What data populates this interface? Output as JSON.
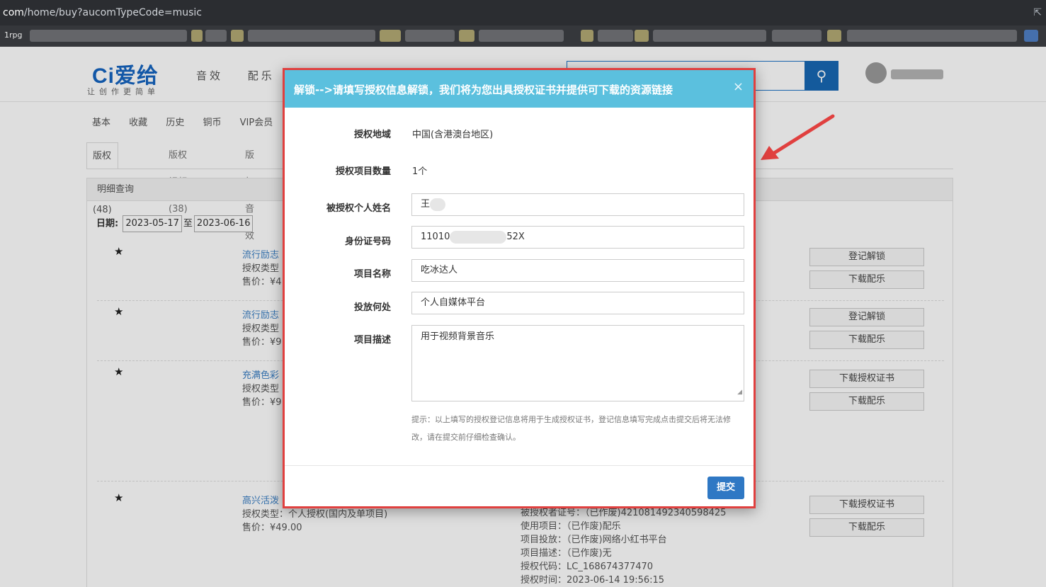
{
  "browser": {
    "url_host": "com",
    "url_path": "/home/buy?aucomTypeCode=music",
    "bookmark_label": "1rpg"
  },
  "site": {
    "logo": "Ci爱给",
    "slogan": "让创作更简单",
    "top_nav": [
      "音效",
      "配乐"
    ],
    "sub_nav": [
      "基本",
      "收藏",
      "历史",
      "铜币",
      "VIP会员"
    ],
    "tabs": [
      "版权配乐(48)",
      "版权视频(38)",
      "版权音效"
    ],
    "panel_title": "明细查询",
    "date_label": "日期:",
    "date_from": "2023-05-17",
    "date_sep": "至",
    "date_to": "2023-06-16"
  },
  "items": [
    {
      "title": "流行励志",
      "type_label": "授权类型",
      "price_label": "售价：",
      "price": "¥4",
      "buttons": [
        "登记解锁",
        "下载配乐"
      ]
    },
    {
      "title": "流行励志",
      "type_label": "授权类型",
      "price_label": "售价：",
      "price": "¥9",
      "buttons": [
        "登记解锁",
        "下载配乐"
      ]
    },
    {
      "title": "充满色彩",
      "type_label": "授权类型",
      "price_label": "售价：",
      "price": "¥9",
      "buttons": [
        "下载授权证书",
        "下载配乐"
      ]
    },
    {
      "title": "高兴活泼",
      "type_label": "授权类型：个人授权(国内及单项目)",
      "price_label": "售价：",
      "price": "¥49.00",
      "buttons": [
        "下载授权证书",
        "下载配乐"
      ],
      "details": [
        "被授权者证号：（已作废)421081492340598425",
        "使用项目：（已作废)配乐",
        "项目投放：（已作废)网络小红书平台",
        "项目描述：（已作废)无",
        "授权代码：LC_168674377470",
        "授权时间：2023-06-14 19:56:15"
      ]
    }
  ],
  "modal": {
    "title": "解锁-->请填写授权信息解锁，我们将为您出具授权证书并提供可下载的资源链接",
    "close": "×",
    "fields": [
      {
        "label": "授权地域",
        "value": "中国(含港澳台地区)"
      },
      {
        "label": "授权项目数量",
        "value": "1个"
      },
      {
        "label": "被授权个人姓名",
        "value": "王"
      },
      {
        "label": "身份证号码",
        "value_start": "11010",
        "value_end": "52X"
      },
      {
        "label": "项目名称",
        "value": "吃冰达人"
      },
      {
        "label": "投放何处",
        "value": "个人自媒体平台"
      },
      {
        "label": "项目描述",
        "value": "用于视频背景音乐"
      }
    ],
    "hint": "提示：以上填写的授权登记信息将用于生成授权证书，登记信息填写完成点击提交后将无法修改，请在提交前仔细检查确认。",
    "submit": "提交"
  },
  "colors": {
    "modal_header": "#5bc0de",
    "highlight_border": "#e0403f",
    "submit": "#2f78c4",
    "link": "#3a7fc4"
  }
}
